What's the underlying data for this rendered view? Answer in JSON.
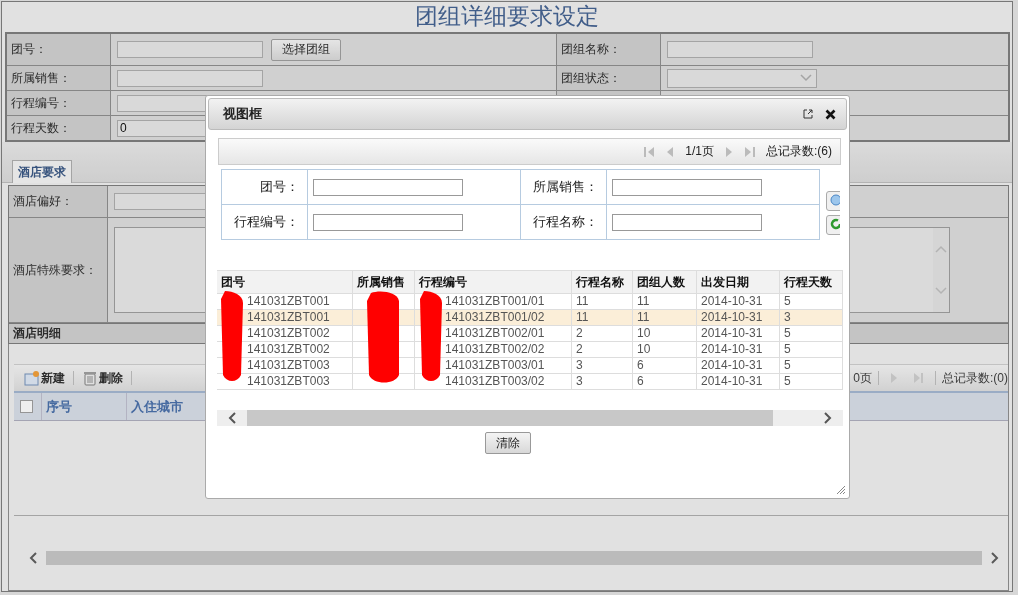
{
  "page": {
    "title": "团组详细要求设定"
  },
  "form": {
    "left": [
      {
        "label": "团号：",
        "kind": "input",
        "button": "选择团组"
      },
      {
        "label": "所属销售：",
        "kind": "input"
      },
      {
        "label": "行程编号：",
        "kind": "input"
      },
      {
        "label": "行程天数：",
        "kind": "input",
        "value": "0"
      }
    ],
    "right": [
      {
        "label": "团组名称：",
        "kind": "input"
      },
      {
        "label": "团组状态：",
        "kind": "select"
      }
    ]
  },
  "tabs": [
    {
      "label": "酒店要求",
      "selected": true
    }
  ],
  "hotel_fields": [
    {
      "label": "酒店偏好：",
      "kind": "input"
    },
    {
      "label": "酒店特殊要求：",
      "kind": "textarea"
    }
  ],
  "detail": {
    "title": "酒店明细",
    "toolbar": [
      {
        "label": "新建",
        "kind": "new"
      },
      {
        "label": "删除",
        "kind": "delete"
      }
    ],
    "pager": {
      "pages": "0页",
      "total": "总记录数:(0)"
    },
    "select_all": {
      "checked": false
    },
    "columns": [
      "序号",
      "入住城市"
    ]
  },
  "dialog": {
    "title": "视图框",
    "pager": {
      "page": "1/1页",
      "total": "总记录数:(6)"
    },
    "search": [
      {
        "label": "团号："
      },
      {
        "label": "所属销售："
      },
      {
        "label": "行程编号："
      },
      {
        "label": "行程名称："
      }
    ],
    "columns": [
      "团号",
      "所属销售",
      "行程编号",
      "行程名称",
      "团组人数",
      "出发日期",
      "行程天数"
    ],
    "rows": [
      {
        "group_no": "141031ZBT001",
        "itinerary_no": "141031ZBT001/01",
        "name": "11",
        "people": "11",
        "date": "2014-10-31",
        "days": "5",
        "selected": false
      },
      {
        "group_no": "141031ZBT001",
        "itinerary_no": "141031ZBT001/02",
        "name": "11",
        "people": "11",
        "date": "2014-10-31",
        "days": "3",
        "selected": true
      },
      {
        "group_no": "141031ZBT002",
        "itinerary_no": "141031ZBT002/01",
        "name": "2",
        "people": "10",
        "date": "2014-10-31",
        "days": "5",
        "selected": false
      },
      {
        "group_no": "141031ZBT002",
        "itinerary_no": "141031ZBT002/02",
        "name": "2",
        "people": "10",
        "date": "2014-10-31",
        "days": "5",
        "selected": false
      },
      {
        "group_no": "141031ZBT003",
        "itinerary_no": "141031ZBT003/01",
        "name": "3",
        "people": "6",
        "date": "2014-10-31",
        "days": "5",
        "selected": false
      },
      {
        "group_no": "141031ZBT003",
        "itinerary_no": "141031ZBT003/02",
        "name": "3",
        "people": "6",
        "date": "2014-10-31",
        "days": "5",
        "selected": false
      }
    ],
    "clear_button": "清除"
  }
}
